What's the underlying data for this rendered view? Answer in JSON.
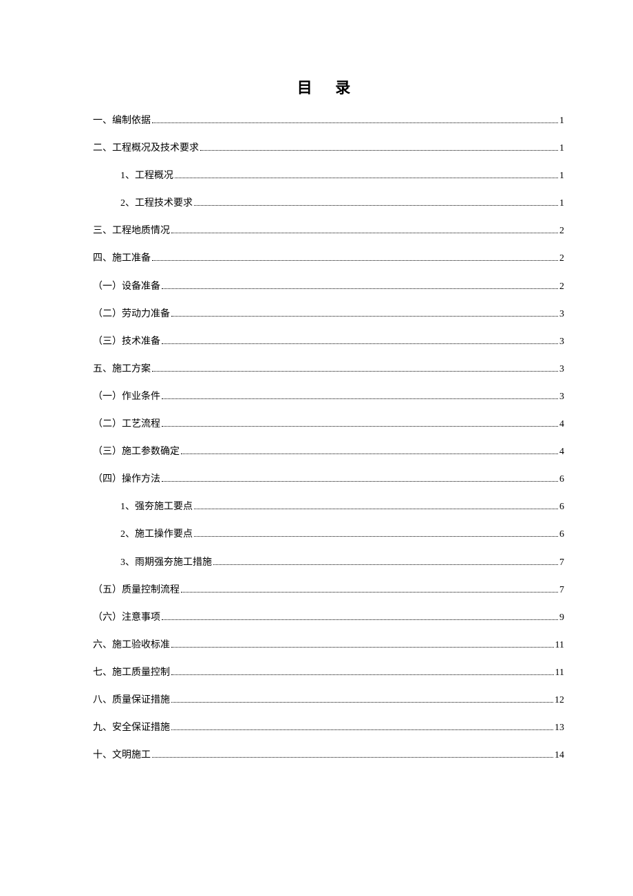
{
  "title": "目 录",
  "entries": [
    {
      "label": "一、编制依据",
      "page": "1",
      "level": 0
    },
    {
      "label": "二、工程概况及技术要求",
      "page": "1",
      "level": 0
    },
    {
      "label": "1、工程概况",
      "page": "1",
      "level": 2
    },
    {
      "label": "2、工程技术要求",
      "page": "1",
      "level": 2
    },
    {
      "label": "三、工程地质情况",
      "page": "2",
      "level": 0
    },
    {
      "label": "四、施工准备",
      "page": "2",
      "level": 0
    },
    {
      "label": "（一）设备准备",
      "page": "2",
      "level": 1
    },
    {
      "label": "（二）劳动力准备",
      "page": "3",
      "level": 1
    },
    {
      "label": "（三）技术准备",
      "page": "3",
      "level": 1
    },
    {
      "label": "五、施工方案",
      "page": "3",
      "level": 0
    },
    {
      "label": "（一）作业条件",
      "page": "3",
      "level": 1
    },
    {
      "label": "（二）工艺流程",
      "page": "4",
      "level": 1
    },
    {
      "label": "（三）施工参数确定",
      "page": "4",
      "level": 1
    },
    {
      "label": "（四）操作方法",
      "page": "6",
      "level": 1
    },
    {
      "label": "1、强夯施工要点",
      "page": "6",
      "level": 2
    },
    {
      "label": "2、施工操作要点",
      "page": "6",
      "level": 2
    },
    {
      "label": "3、雨期强夯施工措施",
      "page": "7",
      "level": 2
    },
    {
      "label": "（五）质量控制流程",
      "page": "7",
      "level": 1
    },
    {
      "label": "（六）注意事项",
      "page": "9",
      "level": 1
    },
    {
      "label": "六、施工验收标准",
      "page": "11",
      "level": 0
    },
    {
      "label": "七、施工质量控制",
      "page": "11",
      "level": 0
    },
    {
      "label": "八、质量保证措施",
      "page": "12",
      "level": 0
    },
    {
      "label": "九、安全保证措施",
      "page": "13",
      "level": 0
    },
    {
      "label": "十、文明施工",
      "page": "14",
      "level": 0
    }
  ]
}
